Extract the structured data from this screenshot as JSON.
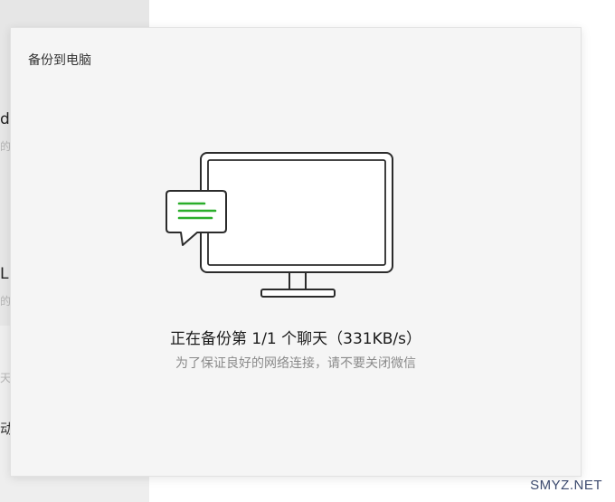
{
  "background_app": {
    "fragments": [
      "d",
      "的",
      "L",
      "的",
      "天",
      "动"
    ]
  },
  "dialog": {
    "title": "备份到电脑",
    "status": "正在备份第 1/1 个聊天（331KB/s）",
    "hint": "为了保证良好的网络连接，请不要关闭微信"
  },
  "colors": {
    "accent_green": "#2aae2a",
    "dialog_bg": "#f5f5f5"
  },
  "icons": {
    "illustration": "monitor-with-chat-bubble-icon"
  },
  "watermark": "SMYZ.NET"
}
